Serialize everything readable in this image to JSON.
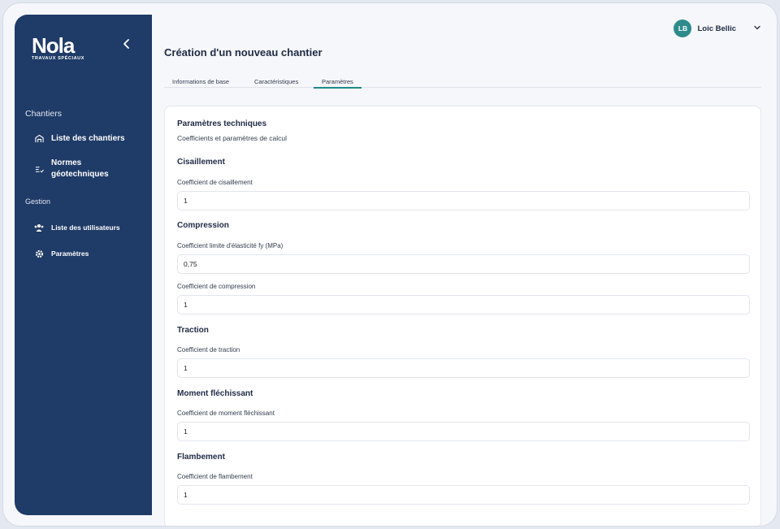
{
  "brand": {
    "logo": "Nola",
    "tagline": "TRAVAUX SPÉCIAUX"
  },
  "sidebar": {
    "section1": "Chantiers",
    "items1": [
      {
        "label": "Liste des chantiers",
        "icon": "building-icon"
      },
      {
        "label": "Normes géotechniques",
        "icon": "list-check-icon"
      }
    ],
    "section2": "Gestion",
    "items2": [
      {
        "label": "Liste des utilisateurs",
        "icon": "users-icon"
      },
      {
        "label": "Paramètres",
        "icon": "gear-icon"
      }
    ]
  },
  "user": {
    "initials": "LB",
    "name": "Loic Bellic"
  },
  "page": {
    "title": "Création d'un nouveau chantier"
  },
  "tabs": [
    "Informations de base",
    "Caractéristiques",
    "Paramètres"
  ],
  "form": {
    "title": "Paramètres techniques",
    "subtitle": "Coefficients et paramètres de calcul",
    "sections": [
      {
        "title": "Cisaillement",
        "fields": [
          {
            "label": "Coefficient de cisaillement",
            "value": "1"
          }
        ]
      },
      {
        "title": "Compression",
        "fields": [
          {
            "label": "Coefficient limite d'élasticité fy (MPa)",
            "value": "0,75"
          },
          {
            "label": "Coefficient de compression",
            "value": "1"
          }
        ]
      },
      {
        "title": "Traction",
        "fields": [
          {
            "label": "Coefficient de traction",
            "value": "1"
          }
        ]
      },
      {
        "title": "Moment fléchissant",
        "fields": [
          {
            "label": "Coefficient de moment fléchissant",
            "value": "1"
          }
        ]
      },
      {
        "title": "Flambement",
        "fields": [
          {
            "label": "Coefficient de flambement",
            "value": "1"
          }
        ]
      }
    ]
  },
  "colors": {
    "sidebar": "#1f3b67",
    "accent": "#1f8a8a",
    "avatar": "#2e8b8b"
  }
}
